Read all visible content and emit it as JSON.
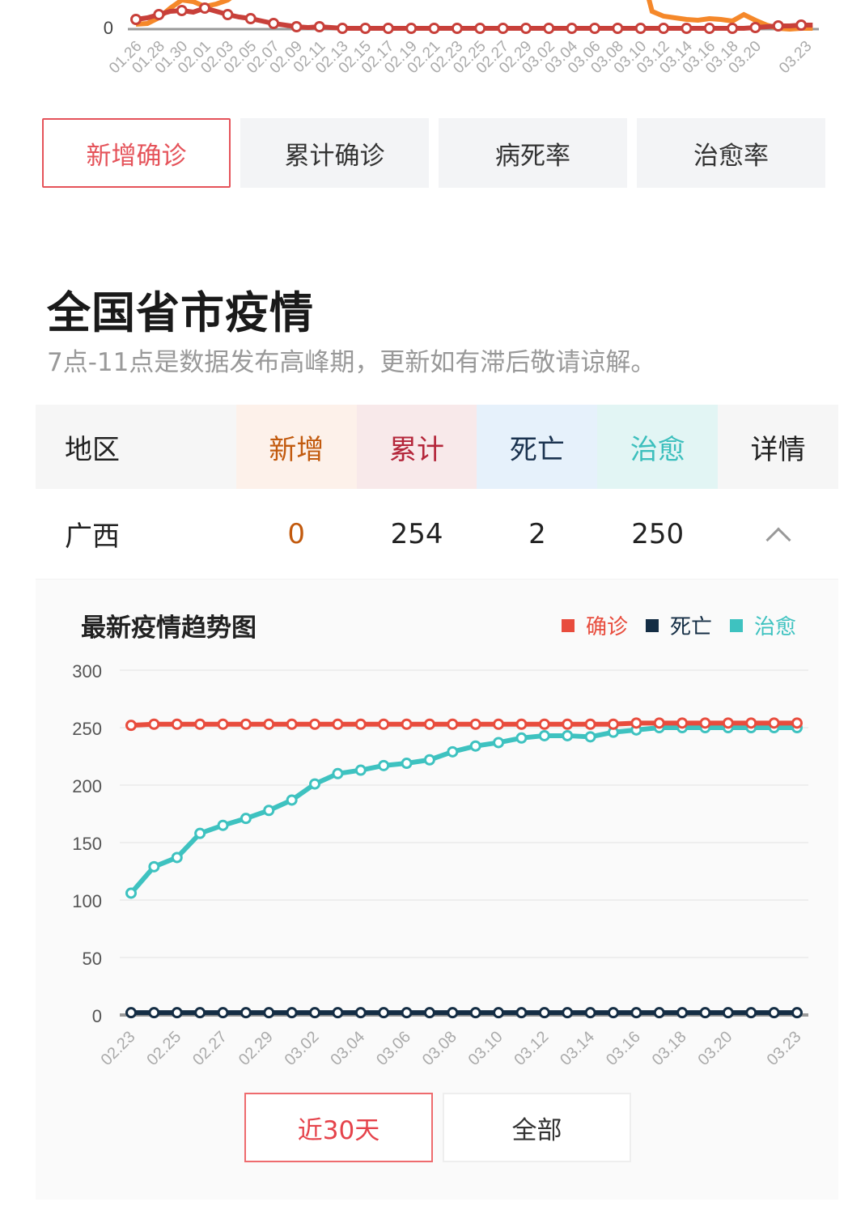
{
  "top_chart": {
    "y_zero_label": "0",
    "x_labels": [
      "01.26",
      "01.28",
      "01.30",
      "02.01",
      "02.03",
      "02.05",
      "02.07",
      "02.09",
      "02.11",
      "02.13",
      "02.15",
      "02.17",
      "02.19",
      "02.21",
      "02.23",
      "02.25",
      "02.27",
      "02.29",
      "03.02",
      "03.04",
      "03.06",
      "03.08",
      "03.10",
      "03.12",
      "03.14",
      "03.16",
      "03.18",
      "03.20",
      "03.23"
    ]
  },
  "tabs": [
    {
      "label": "新增确诊",
      "active": true
    },
    {
      "label": "累计确诊",
      "active": false
    },
    {
      "label": "病死率",
      "active": false
    },
    {
      "label": "治愈率",
      "active": false
    }
  ],
  "section": {
    "title": "全国省市疫情",
    "subtitle": "7点-11点是数据发布高峰期，更新如有滞后敬请谅解。"
  },
  "table": {
    "headers": {
      "region": "地区",
      "new": "新增",
      "total": "累计",
      "death": "死亡",
      "cured": "治愈",
      "detail": "详情"
    },
    "rows": [
      {
        "region": "广西",
        "new": "0",
        "total": "254",
        "death": "2",
        "cured": "250",
        "expanded": true
      }
    ]
  },
  "colors": {
    "confirmed": "#e84c3d",
    "death": "#142d44",
    "cured": "#3ec2c0",
    "active_tab": "#e5535a"
  },
  "chart_data": {
    "type": "line",
    "title": "最新疫情趋势图",
    "legend_position": "top-right",
    "ylim": [
      0,
      300
    ],
    "yticks": [
      0,
      50,
      100,
      150,
      200,
      250,
      300
    ],
    "grid": true,
    "x": [
      "02.23",
      "02.24",
      "02.25",
      "02.26",
      "02.27",
      "02.28",
      "02.29",
      "03.01",
      "03.02",
      "03.03",
      "03.04",
      "03.05",
      "03.06",
      "03.07",
      "03.08",
      "03.09",
      "03.10",
      "03.11",
      "03.12",
      "03.13",
      "03.14",
      "03.15",
      "03.16",
      "03.17",
      "03.18",
      "03.19",
      "03.20",
      "03.21",
      "03.22",
      "03.23"
    ],
    "x_tick_labels": [
      "02.23",
      "02.25",
      "02.27",
      "02.29",
      "03.02",
      "03.04",
      "03.06",
      "03.08",
      "03.10",
      "03.12",
      "03.14",
      "03.16",
      "03.18",
      "03.20",
      "03.23"
    ],
    "series": [
      {
        "name": "确诊",
        "color": "#e84c3d",
        "values": [
          252,
          253,
          253,
          253,
          253,
          253,
          253,
          253,
          253,
          253,
          253,
          253,
          253,
          253,
          253,
          253,
          253,
          253,
          253,
          253,
          253,
          253,
          254,
          254,
          254,
          254,
          254,
          254,
          254,
          254
        ]
      },
      {
        "name": "死亡",
        "color": "#142d44",
        "values": [
          2,
          2,
          2,
          2,
          2,
          2,
          2,
          2,
          2,
          2,
          2,
          2,
          2,
          2,
          2,
          2,
          2,
          2,
          2,
          2,
          2,
          2,
          2,
          2,
          2,
          2,
          2,
          2,
          2,
          2
        ]
      },
      {
        "name": "治愈",
        "color": "#3ec2c0",
        "values": [
          106,
          129,
          137,
          158,
          165,
          171,
          178,
          187,
          201,
          210,
          213,
          217,
          219,
          222,
          229,
          234,
          237,
          241,
          243,
          243,
          242,
          246,
          248,
          250,
          250,
          250,
          250,
          250,
          250,
          250
        ]
      }
    ]
  },
  "range_buttons": [
    {
      "label": "近30天",
      "active": true
    },
    {
      "label": "全部",
      "active": false
    }
  ]
}
